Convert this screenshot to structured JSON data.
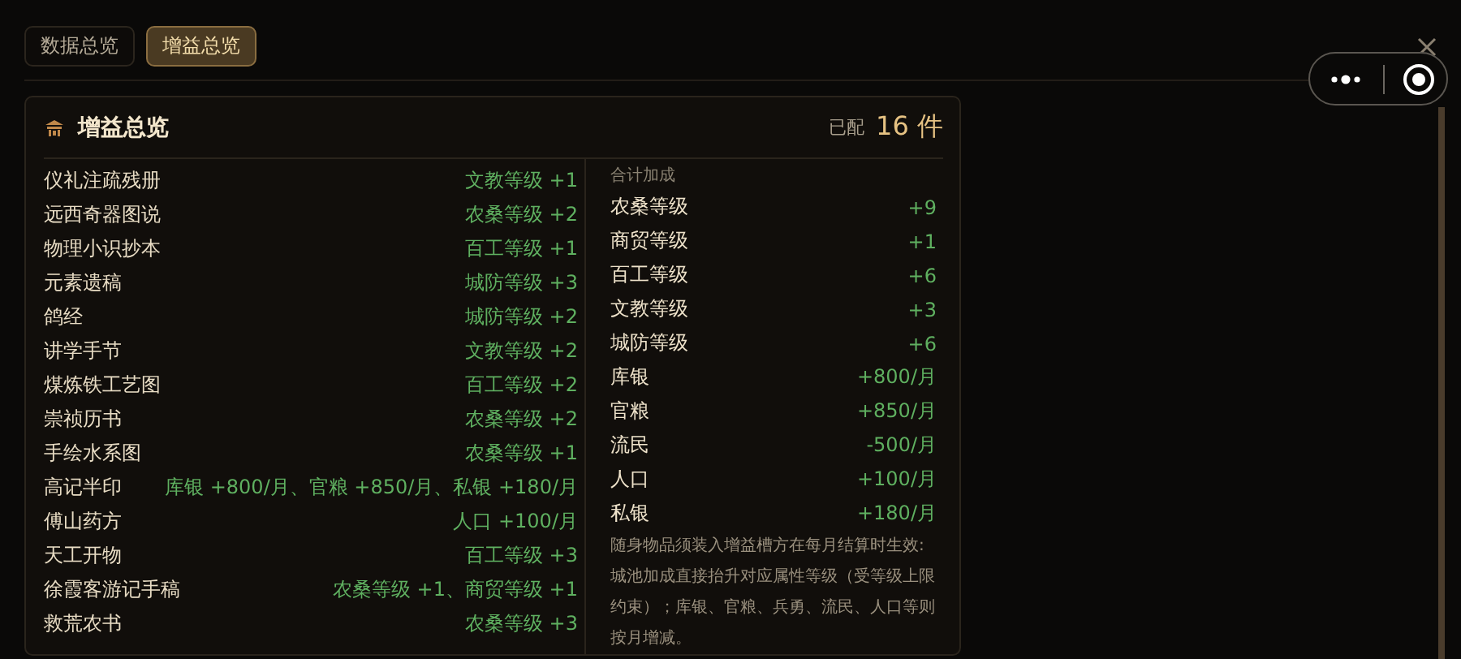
{
  "tabs": [
    {
      "label": "数据总览",
      "selected": false
    },
    {
      "label": "增益总览",
      "selected": true
    }
  ],
  "panel": {
    "title": "增益总览",
    "equipped_label": "已配",
    "equipped_count": "16 件",
    "items": [
      {
        "name": "仪礼注疏残册",
        "effect": "文教等级 +1"
      },
      {
        "name": "远西奇器图说",
        "effect": "农桑等级 +2"
      },
      {
        "name": "物理小识抄本",
        "effect": "百工等级 +1"
      },
      {
        "name": "元素遗稿",
        "effect": "城防等级 +3"
      },
      {
        "name": "鸽经",
        "effect": "城防等级 +2"
      },
      {
        "name": "讲学手节",
        "effect": "文教等级 +2"
      },
      {
        "name": "煤炼铁工艺图",
        "effect": "百工等级 +2"
      },
      {
        "name": "崇祯历书",
        "effect": "农桑等级 +2"
      },
      {
        "name": "手绘水系图",
        "effect": "农桑等级 +1"
      },
      {
        "name": "高记半印",
        "effect": "库银 +800/月、官粮 +850/月、私银 +180/月"
      },
      {
        "name": "傅山药方",
        "effect": "人口 +100/月"
      },
      {
        "name": "天工开物",
        "effect": "百工等级 +3"
      },
      {
        "name": "徐霞客游记手稿",
        "effect": "农桑等级 +1、商贸等级 +1"
      },
      {
        "name": "救荒农书",
        "effect": "农桑等级 +3"
      }
    ],
    "totals_heading": "合计加成",
    "totals": [
      {
        "name": "农桑等级",
        "value": "+9"
      },
      {
        "name": "商贸等级",
        "value": "+1"
      },
      {
        "name": "百工等级",
        "value": "+6"
      },
      {
        "name": "文教等级",
        "value": "+3"
      },
      {
        "name": "城防等级",
        "value": "+6"
      },
      {
        "name": "库银",
        "value": "+800/月"
      },
      {
        "name": "官粮",
        "value": "+850/月"
      },
      {
        "name": "流民",
        "value": "-500/月"
      },
      {
        "name": "人口",
        "value": "+100/月"
      },
      {
        "name": "私银",
        "value": "+180/月"
      }
    ],
    "note": "随身物品须装入增益槽方在每月结算时生效:城池加成直接抬升对应属性等级（受等级上限约束）；库银、官粮、兵勇、流民、人口等则按月增减。"
  }
}
